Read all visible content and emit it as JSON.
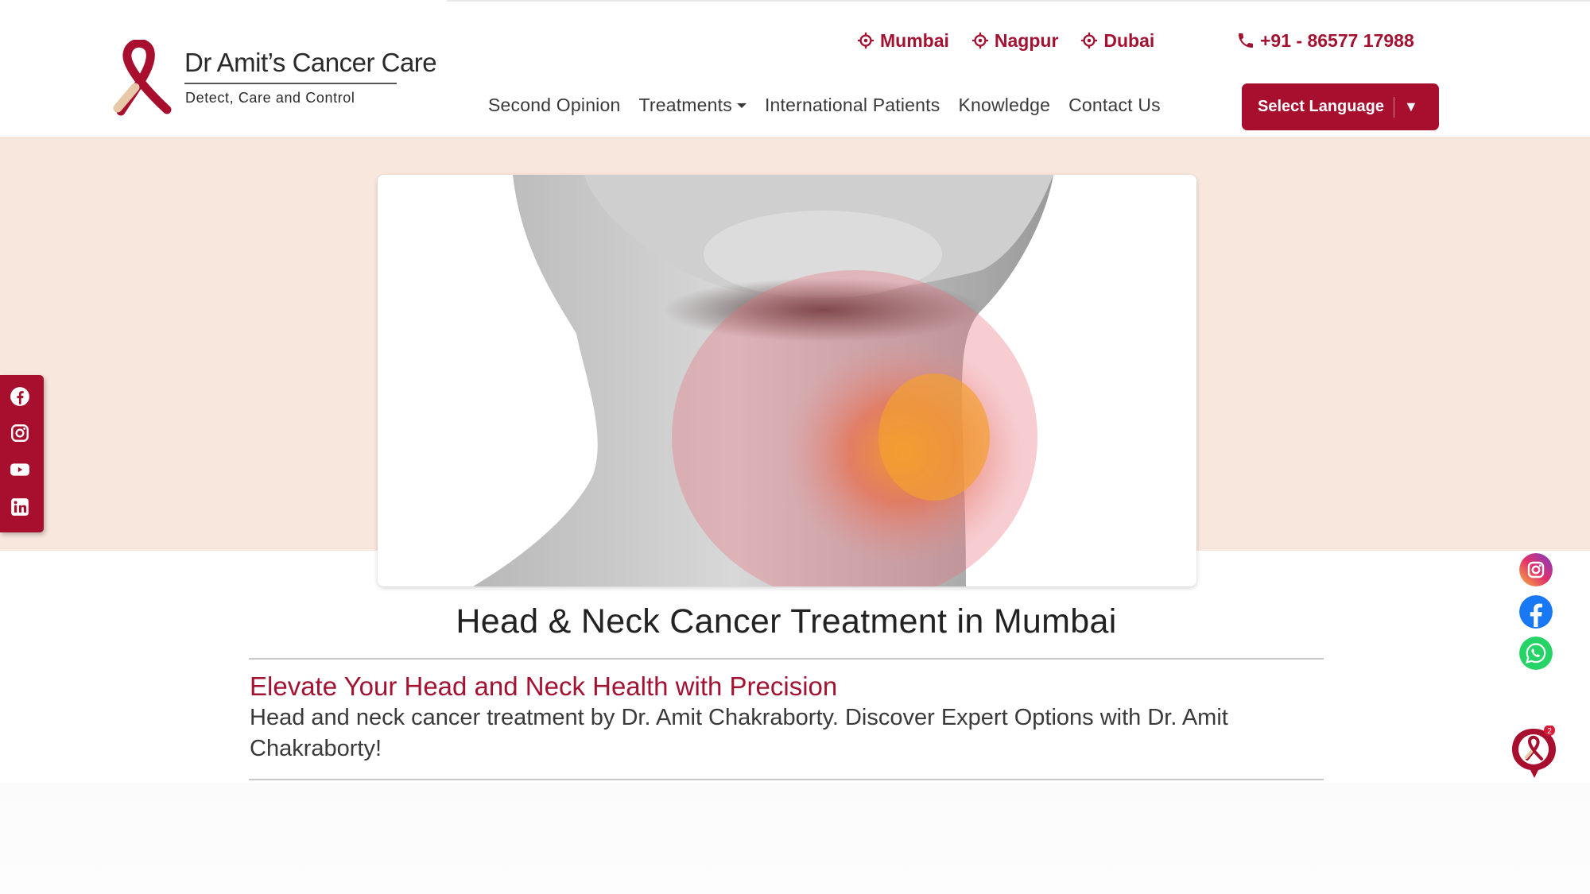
{
  "header": {
    "logo": {
      "title": "Dr Amit’s Cancer Care",
      "tagline": "Detect, Care and Control"
    },
    "locations": [
      "Mumbai",
      "Nagpur",
      "Dubai"
    ],
    "phone": "+91 - 86577 17988",
    "nav": [
      "Second Opinion",
      "Treatments",
      "International Patients",
      "Knowledge",
      "Contact Us"
    ],
    "language_button": "Select Language",
    "language_arrow": "▼"
  },
  "social_left": [
    "facebook-icon",
    "instagram-icon",
    "youtube-icon",
    "linkedin-icon"
  ],
  "social_right": [
    "instagram-icon",
    "facebook-icon",
    "whatsapp-icon"
  ],
  "chat": {
    "badge": "2"
  },
  "content": {
    "title": "Head & Neck Cancer Treatment in Mumbai",
    "subtitle": "Elevate Your Head and Neck Health with Precision",
    "description": "Head and neck cancer treatment by Dr. Amit Chakraborty. Discover Expert Options with Dr. Amit Chakraborty!"
  },
  "colors": {
    "brand": "#a80f2f",
    "hero_background": "#f8e7dd",
    "text": "#2b2b2b"
  }
}
